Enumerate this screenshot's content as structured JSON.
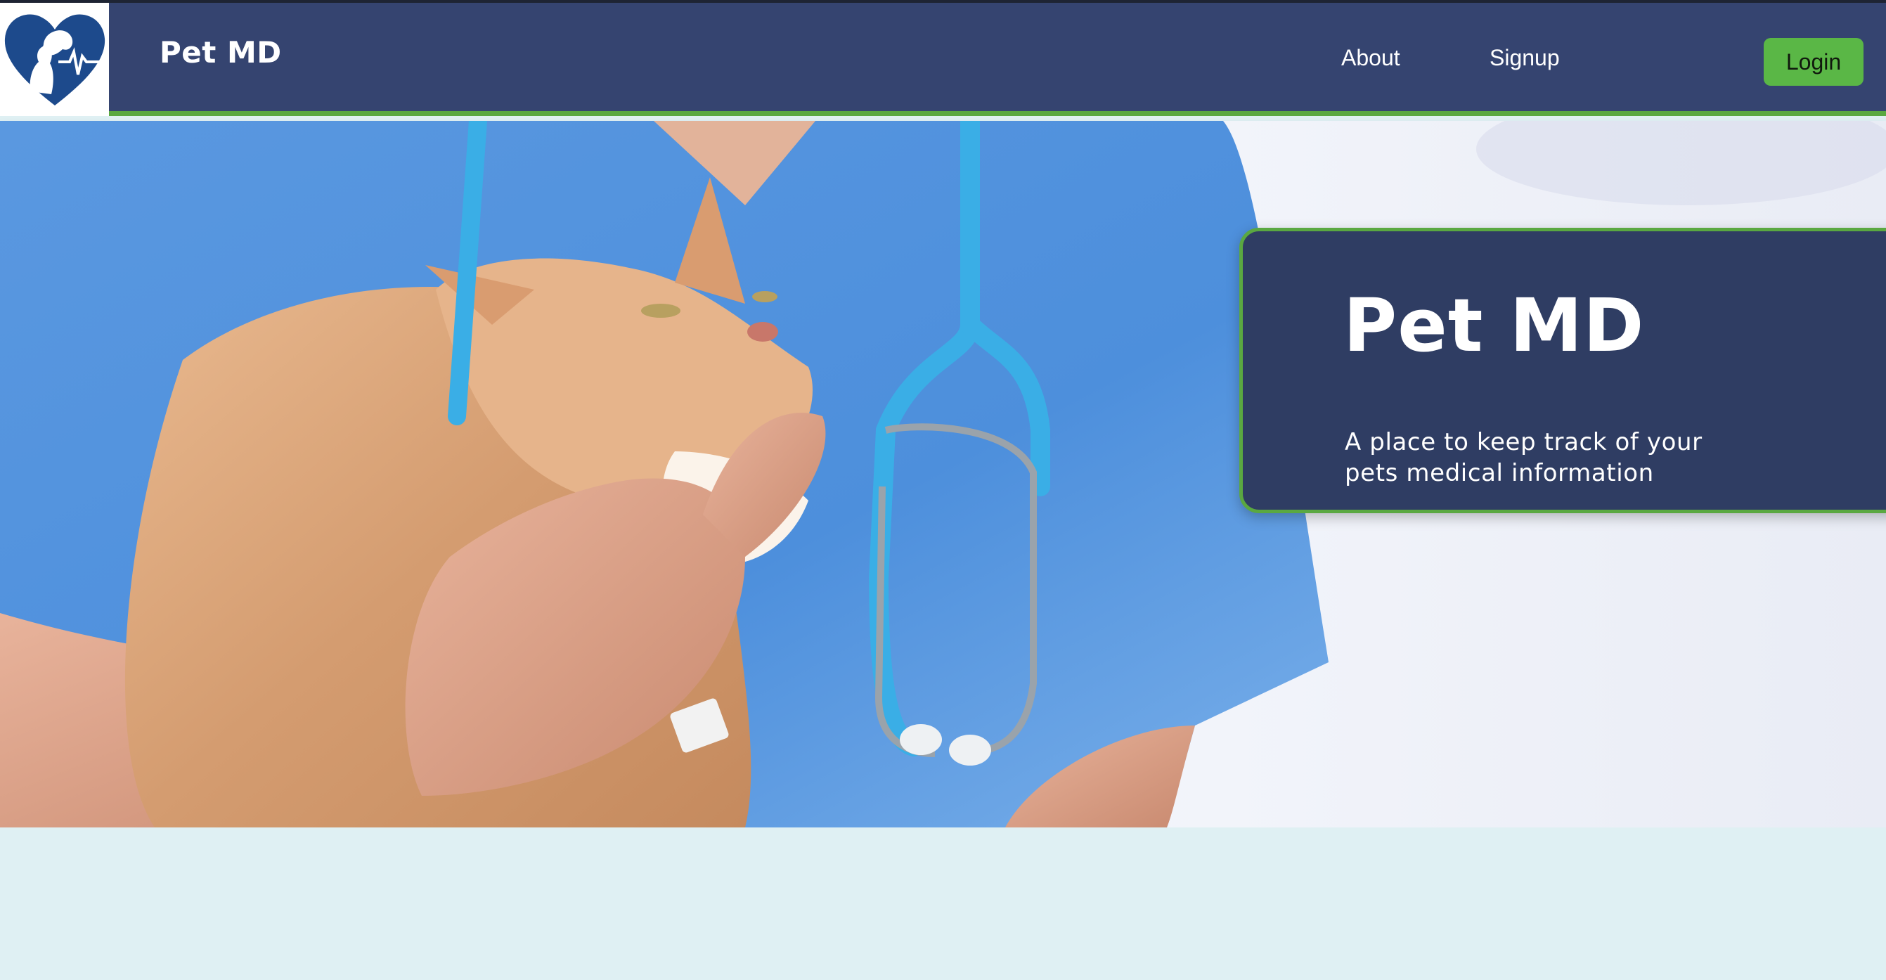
{
  "header": {
    "brand": "Pet MD",
    "nav": [
      {
        "label": "About"
      },
      {
        "label": "Signup"
      }
    ],
    "login_label": "Login",
    "logo_icon": "heart-pet-heartbeat-logo"
  },
  "hero": {
    "title": "Pet MD",
    "subtitle": "A place to keep track of your pets medical information",
    "image": "vet-holding-cat-photo"
  },
  "colors": {
    "nav_bg": "#354470",
    "accent_green": "#5aa841",
    "login_bg": "#5ab746",
    "card_bg": "#2f3d63",
    "page_bg": "#dff0f3"
  }
}
